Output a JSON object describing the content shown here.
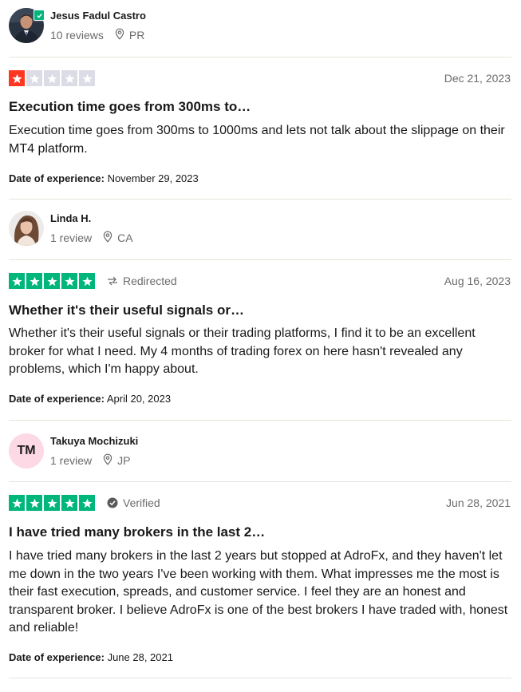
{
  "reviews": [
    {
      "reviewer_name": "Jesus Fadul Castro",
      "review_count": "10 reviews",
      "country": "PR",
      "avatar": "photo",
      "verified_profile": true,
      "rating": 1,
      "rating_max": 5,
      "tag": "",
      "date": "Dec 21, 2023",
      "title": "Execution time goes from 300ms to…",
      "body": "Execution time goes from 300ms to 1000ms and lets not talk about the slippage on their MT4 platform.",
      "experience_label": "Date of experience:",
      "experience_date": "November 29, 2023"
    },
    {
      "reviewer_name": "Linda H.",
      "review_count": "1 review",
      "country": "CA",
      "avatar": "photo",
      "verified_profile": false,
      "rating": 5,
      "rating_max": 5,
      "tag": "Redirected",
      "tag_icon": "redirect-arrow-icon",
      "date": "Aug 16, 2023",
      "title": "Whether it's their useful signals or…",
      "body": "Whether it's their useful signals or their trading platforms, I find it to be an excellent broker for what I need. My 4 months of trading forex on here hasn't revealed any problems, which I'm happy about.",
      "experience_label": "Date of experience:",
      "experience_date": "April 20, 2023"
    },
    {
      "reviewer_name": "Takuya Mochizuki",
      "review_count": "1 review",
      "country": "JP",
      "avatar": "initials",
      "initials": "TM",
      "verified_profile": false,
      "rating": 5,
      "rating_max": 5,
      "tag": "Verified",
      "tag_icon": "verified-check-icon",
      "date": "Jun 28, 2021",
      "title": "I have tried many brokers in the last 2…",
      "body": "I have tried many brokers in the last 2 years but stopped at AdroFx, and they haven't let me down in the two years I've been working with them. What impresses me the most is their fast execution, spreads, and customer service. I feel they are an honest and transparent broker. I believe AdroFx is one of the best brokers I have traded with, honest and reliable!",
      "experience_label": "Date of experience:",
      "experience_date": "June 28, 2021"
    }
  ],
  "colors": {
    "star_one": "#ff3722",
    "star_five": "#00b67a",
    "star_empty": "#dcdce6",
    "muted_text": "#6b6b6b",
    "divider": "#e5e5dd",
    "initials_bg": "#fcd9e4"
  }
}
